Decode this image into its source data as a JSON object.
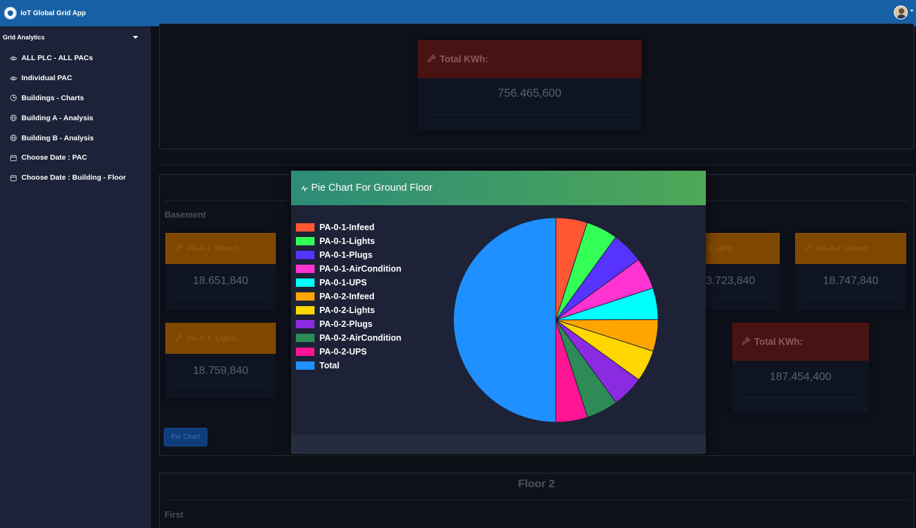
{
  "app": {
    "title": "IoT Global Grid App"
  },
  "sidebar": {
    "header": "Grid Analytics",
    "items": [
      {
        "label": "ALL PLC - ALL PACs",
        "icon": "eye-icon"
      },
      {
        "label": "Individual PAC",
        "icon": "eye-icon"
      },
      {
        "label": "Buildings - Charts",
        "icon": "pie-chart-icon"
      },
      {
        "label": "Building A - Analysis",
        "icon": "globe-icon"
      },
      {
        "label": "Building B - Analysis",
        "icon": "globe-icon"
      },
      {
        "label": "Choose Date : PAC",
        "icon": "calendar-icon"
      },
      {
        "label": "Choose Date : Building - Floor",
        "icon": "calendar-icon"
      }
    ]
  },
  "main": {
    "top_total": {
      "label": "Total KWh:",
      "value": "756.465,600"
    },
    "basement_section": {
      "label": "Basement",
      "cards": [
        {
          "label": "PA-0-1_Infeed:",
          "value": "18.651,840"
        },
        {
          "label": "-1_UPS:",
          "value": "3.723,840"
        },
        {
          "label": "PA-0-2_Infeed:",
          "value": "18.747,840"
        },
        {
          "label": "PA-0-2_Lights:",
          "value": "18.759,840"
        }
      ],
      "total": {
        "label": "Total KWh:",
        "value": "187.454,400"
      },
      "pie_button": "Pie Chart"
    },
    "floor2_section": {
      "title": "Floor 2",
      "label": "First"
    }
  },
  "modal": {
    "title": "Pie Chart For Ground Floor",
    "title_icon": "activity-icon"
  },
  "chart_data": {
    "type": "pie",
    "title": "Pie Chart For Ground Floor",
    "legend_position": "left",
    "series": [
      {
        "name": "PA-0-1-Infeed",
        "value": 18651.84,
        "color": "#ff5733"
      },
      {
        "name": "PA-0-1-Lights",
        "value": 18700.0,
        "color": "#33ff57"
      },
      {
        "name": "PA-0-1-Plugs",
        "value": 18710.0,
        "color": "#5733ff"
      },
      {
        "name": "PA-0-1-AirCondition",
        "value": 18720.0,
        "color": "#ff33d1"
      },
      {
        "name": "PA-0-1-UPS",
        "value": 18723.84,
        "color": "#00ffff"
      },
      {
        "name": "PA-0-2-Infeed",
        "value": 18747.84,
        "color": "#ffa500"
      },
      {
        "name": "PA-0-2-Lights",
        "value": 18759.84,
        "color": "#ffd700"
      },
      {
        "name": "PA-0-2-Plugs",
        "value": 18790.0,
        "color": "#8a2be2"
      },
      {
        "name": "PA-0-2-AirCondition",
        "value": 18800.0,
        "color": "#2e8b57"
      },
      {
        "name": "PA-0-2-UPS",
        "value": 18851.04,
        "color": "#ff1493"
      },
      {
        "name": "Total",
        "value": 187454.4,
        "color": "#1e90ff"
      }
    ]
  }
}
